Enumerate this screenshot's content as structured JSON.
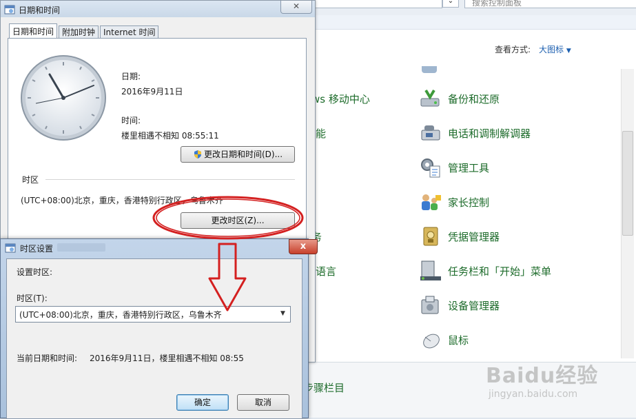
{
  "control_panel": {
    "search_placeholder": "搜索控制面板",
    "view_by_label": "查看方式:",
    "view_by_value": "大图标",
    "left_fragments": [
      "ws 移动中心",
      "能",
      "务",
      "语言"
    ],
    "bottom_fragment": "步骤栏目",
    "items": [
      {
        "label": "备份和还原",
        "icon": "backup-restore-icon"
      },
      {
        "label": "电话和调制解调器",
        "icon": "phone-modem-icon"
      },
      {
        "label": "管理工具",
        "icon": "admin-tools-icon"
      },
      {
        "label": "家长控制",
        "icon": "parental-controls-icon"
      },
      {
        "label": "凭据管理器",
        "icon": "credential-manager-icon"
      },
      {
        "label": "任务栏和「开始」菜单",
        "icon": "taskbar-start-icon"
      },
      {
        "label": "设备管理器",
        "icon": "device-manager-icon"
      },
      {
        "label": "鼠标",
        "icon": "mouse-icon"
      }
    ]
  },
  "datetime_dialog": {
    "title": "日期和时间",
    "tabs": [
      "日期和时间",
      "附加时钟",
      "Internet 时间"
    ],
    "date_label": "日期:",
    "date_value": "2016年9月11日",
    "time_label": "时间:",
    "time_value": "楼里相遇不相知 08:55:11",
    "change_datetime_button": "更改日期和时间(D)...",
    "timezone_section": "时区",
    "timezone_value": "(UTC+08:00)北京，重庆，香港特别行政区，乌鲁木齐",
    "change_timezone_button": "更改时区(Z)..."
  },
  "timezone_dialog": {
    "title": "时区设置",
    "set_timezone_label": "设置时区:",
    "timezone_field_label": "时区(T):",
    "timezone_selected": "(UTC+08:00)北京，重庆，香港特别行政区，乌鲁木齐",
    "current_label": "当前日期和时间:",
    "current_value": "2016年9月11日，楼里相遇不相知 08:55",
    "ok_button": "确定",
    "cancel_button": "取消",
    "close_glyph": "x"
  },
  "watermark": {
    "brand": "Baidu经验",
    "url": "jingyan.baidu.com"
  },
  "colors": {
    "link_green": "#1c6b2a",
    "link_blue": "#1c5fb0",
    "annotation_red": "#d42020"
  }
}
